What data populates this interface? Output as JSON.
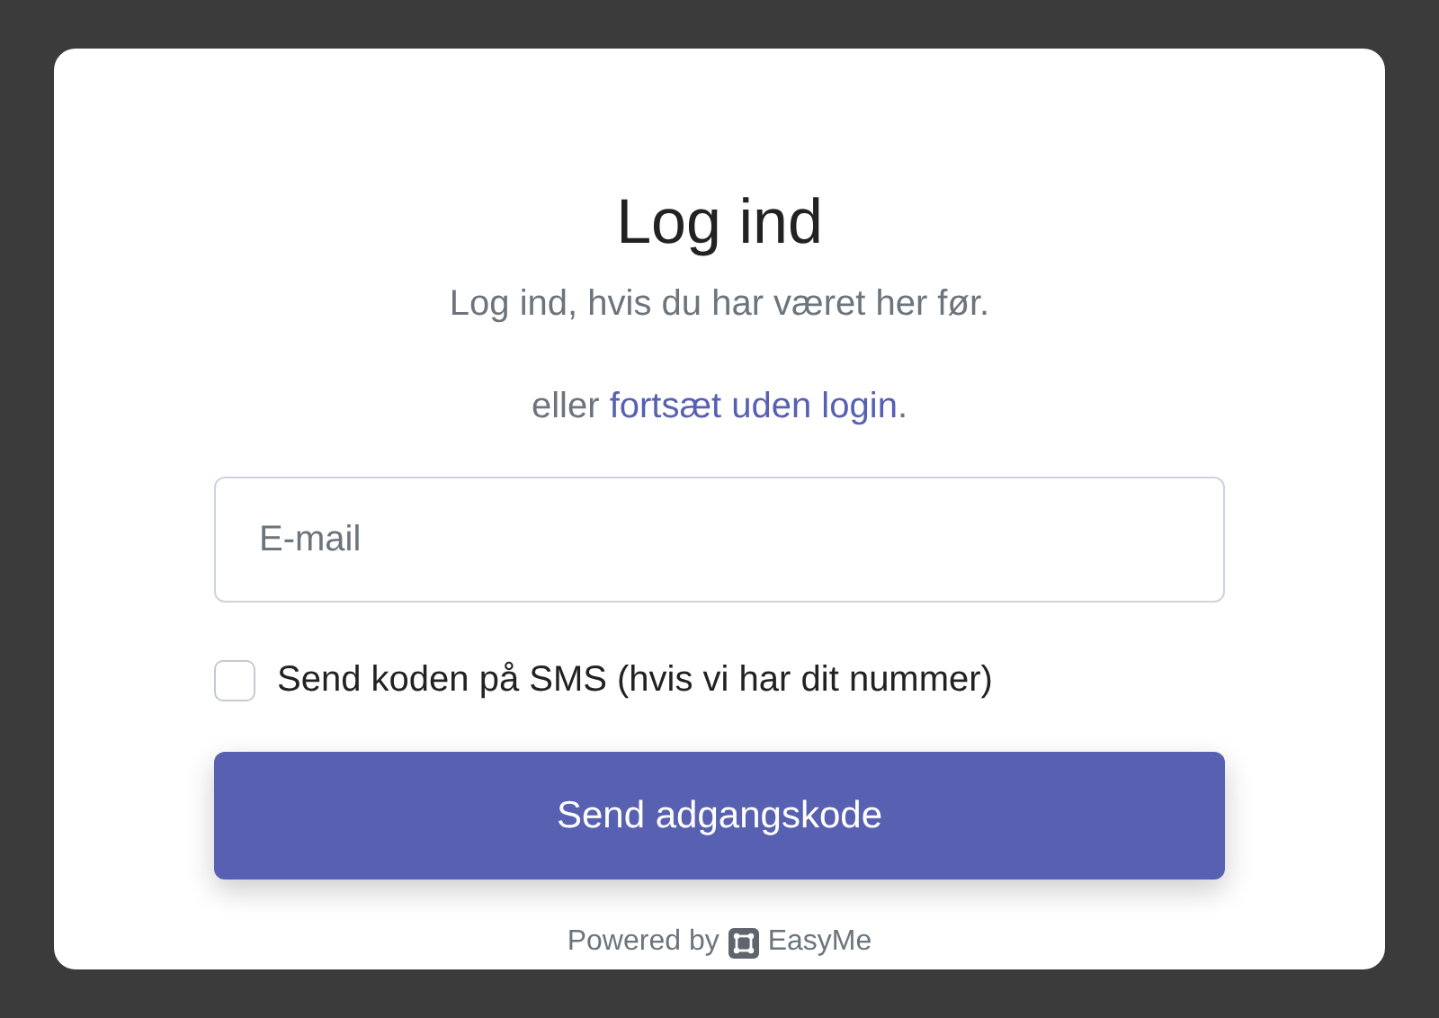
{
  "title": "Log ind",
  "subtitle": "Log ind, hvis du har været her før.",
  "alternative": {
    "prefix": "eller ",
    "link": "fortsæt uden login",
    "suffix": "."
  },
  "email_field": {
    "placeholder": "E-mail"
  },
  "sms_option": {
    "label": "Send koden på SMS (hvis vi har dit nummer)",
    "checked": false
  },
  "submit_button": "Send adgangskode",
  "footer": {
    "prefix": "Powered by",
    "brand": "EasyMe"
  }
}
